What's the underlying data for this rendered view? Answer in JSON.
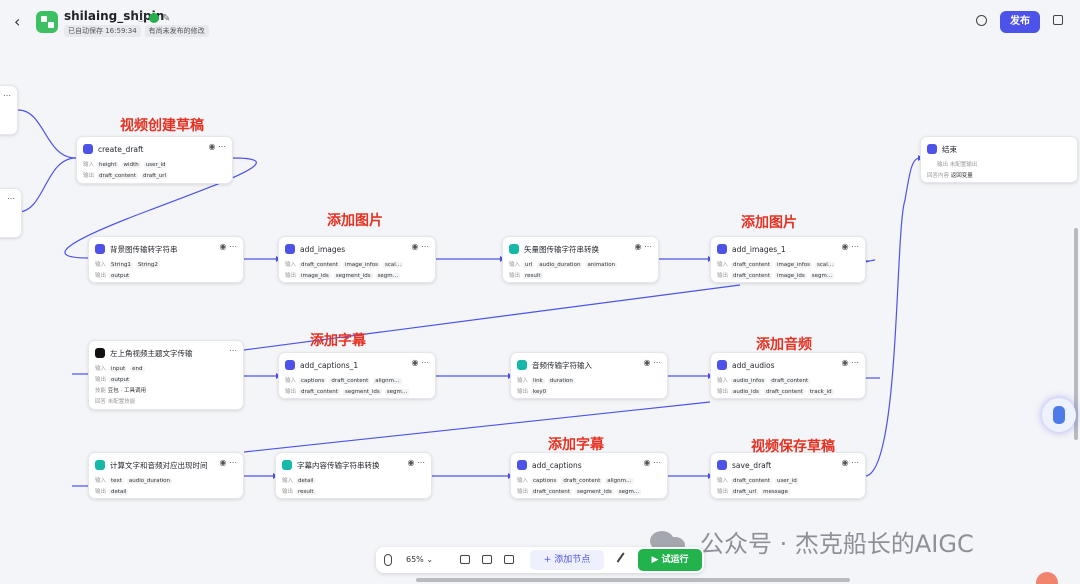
{
  "header": {
    "back_icon": "‹",
    "title": "shilaing_shipin",
    "autosave": "已自动保存 16:59:34",
    "unpublished": "有尚未发布的修改",
    "publish_label": "发布"
  },
  "nodes": {
    "create_draft": {
      "title": "create_draft",
      "in_label": "输入",
      "out_label": "输出",
      "in": [
        "height",
        "width",
        "user_id"
      ],
      "out": [
        "draft_content",
        "draft_url"
      ]
    },
    "bg_conv": {
      "title": "背景图传输转字符串",
      "in_label": "输入",
      "out_label": "输出",
      "in": [
        "String1",
        "String2"
      ],
      "out": [
        "output"
      ]
    },
    "add_images": {
      "title": "add_images",
      "in_label": "输入",
      "out_label": "输出",
      "in": [
        "draft_content",
        "image_infos",
        "scal…"
      ],
      "out": [
        "image_ids",
        "segment_ids",
        "segm…"
      ]
    },
    "vec_conv": {
      "title": "矢量图传输字符串转换",
      "in_label": "输入",
      "out_label": "输出",
      "in": [
        "url",
        "audio_duration",
        "animation"
      ],
      "out": [
        "result"
      ]
    },
    "add_images_1": {
      "title": "add_images_1",
      "in_label": "输入",
      "out_label": "输出",
      "in": [
        "draft_content",
        "image_infos",
        "scal…"
      ],
      "out": [
        "draft_content",
        "image_ids",
        "segm…"
      ]
    },
    "topic": {
      "title": "左上角视频主题文字传输",
      "in_label": "输入",
      "out_label": "输出",
      "in": [
        "input",
        "end"
      ],
      "out": [
        "output"
      ],
      "skill_label": "技能",
      "skill": "豆包 · 工具调用",
      "answer_label": "回答",
      "answer": "未配置技能"
    },
    "add_captions_1": {
      "title": "add_captions_1",
      "in_label": "输入",
      "out_label": "输出",
      "in": [
        "captions",
        "draft_content",
        "alignm…"
      ],
      "out": [
        "draft_content",
        "segment_ids",
        "segm…"
      ]
    },
    "audio_conv": {
      "title": "音频传输字符输入",
      "in_label": "输入",
      "out_label": "输出",
      "in": [
        "link",
        "duration"
      ],
      "out": [
        "key0"
      ]
    },
    "add_audios": {
      "title": "add_audios",
      "in_label": "输入",
      "out_label": "输出",
      "in": [
        "audio_infos",
        "draft_content"
      ],
      "out": [
        "audio_ids",
        "draft_content",
        "track_id"
      ]
    },
    "calc_time": {
      "title": "计算文字和音频对应出现时间",
      "in_label": "输入",
      "out_label": "输出",
      "in": [
        "text",
        "audio_duration"
      ],
      "out": [
        "detail"
      ]
    },
    "caption_conv": {
      "title": "字幕内容传输字符串转换",
      "in_label": "输入",
      "out_label": "输出",
      "in": [
        "detail"
      ],
      "out": [
        "result"
      ]
    },
    "add_captions": {
      "title": "add_captions",
      "in_label": "输入",
      "out_label": "输出",
      "in": [
        "captions",
        "draft_content",
        "alignm…"
      ],
      "out": [
        "draft_content",
        "segment_ids",
        "segm…"
      ]
    },
    "save_draft": {
      "title": "save_draft",
      "in_label": "输入",
      "out_label": "输出",
      "in": [
        "draft_content",
        "user_id"
      ],
      "out": [
        "draft_url",
        "message"
      ]
    },
    "end": {
      "title": "结束",
      "row1_label": "输出",
      "row1": "未配置输出",
      "row2_label": "回答内容",
      "row2": "返回变量"
    }
  },
  "annotations": {
    "a1": "视频创建草稿",
    "a2": "添加图片",
    "a3": "添加图片",
    "a4": "添加字幕",
    "a5": "添加音频",
    "a6": "添加字幕",
    "a7": "视频保存草稿"
  },
  "toolbar": {
    "zoom": "65%",
    "add_node": "+ 添加节点",
    "run": "▶ 试运行"
  },
  "watermark": "公众号 · 杰克船长的AIGC",
  "colors": {
    "accent": "#4d53e8",
    "run_green": "#22b34d",
    "annotation_red": "#e53223",
    "plugin_icon": "#4d53e8",
    "code_icon": "#16b9a8",
    "llm_icon": "#111111",
    "end_icon": "#4d53e8",
    "app_logo": "#3cc062"
  }
}
